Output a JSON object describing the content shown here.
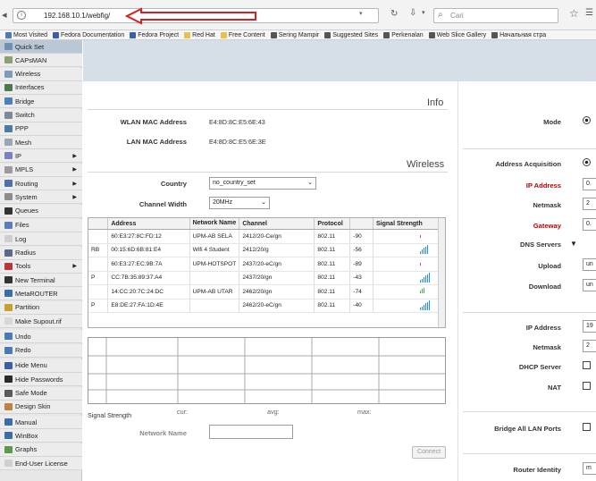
{
  "browser": {
    "url": "192.168.10.1/webfig/",
    "search_placeholder": "Cari"
  },
  "bookmarks": [
    "Most Visited",
    "Fedora Documentation",
    "Fedora Project",
    "Red Hat",
    "Free Content",
    "Sering Mampir",
    "Suggested Sites",
    "Perkenalan",
    "Web Slice Gallery",
    "Начальная стра"
  ],
  "sidebar": {
    "items": [
      {
        "label": "Quick Set",
        "color": "#6e8fb0",
        "arrow": ""
      },
      {
        "label": "CAPsMAN",
        "color": "#8aa070",
        "arrow": ""
      },
      {
        "label": "Wireless",
        "color": "#7d9cb8",
        "arrow": ""
      },
      {
        "label": "Interfaces",
        "color": "#4a7a4a",
        "arrow": ""
      },
      {
        "label": "Bridge",
        "color": "#4b7fc0",
        "arrow": ""
      },
      {
        "label": "Switch",
        "color": "#7f8a99",
        "arrow": ""
      },
      {
        "label": "PPP",
        "color": "#4a7aa8",
        "arrow": ""
      },
      {
        "label": "Mesh",
        "color": "#9aa6b3",
        "arrow": ""
      },
      {
        "label": "IP",
        "color": "#7b7fc6",
        "arrow": "▶"
      },
      {
        "label": "MPLS",
        "color": "#9b9b9b",
        "arrow": "▶"
      },
      {
        "label": "Routing",
        "color": "#4c6fb0",
        "arrow": "▶"
      },
      {
        "label": "System",
        "color": "#8c8c8c",
        "arrow": "▶"
      },
      {
        "label": "Queues",
        "color": "#333333",
        "arrow": ""
      },
      {
        "label": "Files",
        "color": "#5b7fb5",
        "arrow": ""
      },
      {
        "label": "Log",
        "color": "#cfcfcf",
        "arrow": ""
      },
      {
        "label": "Radius",
        "color": "#5a6a8a",
        "arrow": ""
      },
      {
        "label": "Tools",
        "color": "#b83838",
        "arrow": "▶"
      },
      {
        "label": "New Terminal",
        "color": "#333333",
        "arrow": ""
      },
      {
        "label": "MetaROUTER",
        "color": "#3b6ea8",
        "arrow": ""
      },
      {
        "label": "Partition",
        "color": "#c8a030",
        "arrow": ""
      },
      {
        "label": "Make Supout.rif",
        "color": "#d7d7d7",
        "arrow": ""
      },
      {
        "label": "Undo",
        "color": "#4a7ab8",
        "arrow": ""
      },
      {
        "label": "Redo",
        "color": "#4a7ab8",
        "arrow": ""
      },
      {
        "label": "Hide Menu",
        "color": "#3b5ea8",
        "arrow": ""
      },
      {
        "label": "Hide Passwords",
        "color": "#2a2a2a",
        "arrow": ""
      },
      {
        "label": "Safe Mode",
        "color": "#5a5a5a",
        "arrow": ""
      },
      {
        "label": "Design Skin",
        "color": "#c08040",
        "arrow": ""
      },
      {
        "label": "Manual",
        "color": "#3b6ea8",
        "arrow": ""
      },
      {
        "label": "WinBox",
        "color": "#3b6ea8",
        "arrow": ""
      },
      {
        "label": "Graphs",
        "color": "#5a9a4a",
        "arrow": ""
      },
      {
        "label": "End-User License",
        "color": "#cfcfcf",
        "arrow": ""
      }
    ]
  },
  "info": {
    "title": "Info",
    "wlan_mac_label": "WLAN MAC Address",
    "wlan_mac": "E4:8D:8C:E5:6E:43",
    "lan_mac_label": "LAN MAC Address",
    "lan_mac": "E4:8D:8C:E5:6E:3E"
  },
  "wireless": {
    "title": "Wireless",
    "country_label": "Country",
    "country": "no_country_set",
    "channel_width_label": "Channel Width",
    "channel_width": "20MHz",
    "columns": [
      "Address",
      "Network Name",
      "Channel",
      "Protocol",
      "",
      "Signal Strength"
    ],
    "rows": [
      {
        "flag": "",
        "address": "60:E3:27:8C:FD:12",
        "name": "UPM-AB SELA",
        "channel": "2412/20-Ce/gn",
        "protocol": "802.11",
        "signal": "-90",
        "color": "#e05030"
      },
      {
        "flag": "RB",
        "address": "00:15:6D:6B:81:E4",
        "name": "Wifi 4 Student",
        "channel": "2412/20/g",
        "protocol": "802.11",
        "signal": "-56",
        "color": "#2f8fd8"
      },
      {
        "flag": "",
        "address": "60:E3:27:EC:9B:7A",
        "name": "UPM-HOTSPOT",
        "channel": "2437/20-eC/gn",
        "protocol": "802.11",
        "signal": "-89",
        "color": "#e05030"
      },
      {
        "flag": "P",
        "address": "CC:7B:35:89:37:A4",
        "name": "",
        "channel": "2437/20/gn",
        "protocol": "802.11",
        "signal": "-43",
        "color": "#2f8fd8"
      },
      {
        "flag": "",
        "address": "14:CC:20:7C:24:DC",
        "name": "UPM-AB UTAR",
        "channel": "2462/20/gn",
        "protocol": "802.11",
        "signal": "-74",
        "color": "#4caa50"
      },
      {
        "flag": "P",
        "address": "E8:DE:27:FA:1D:4E",
        "name": "",
        "channel": "2462/20-eC/gn",
        "protocol": "802.11",
        "signal": "-40",
        "color": "#2f8fd8"
      }
    ],
    "signal_label": "Signal Strength",
    "cur_label": "cur:",
    "avg_label": "avg:",
    "max_label": "max:",
    "network_name_label": "Network Name",
    "connect_label": "Connect"
  },
  "right": {
    "mode_label": "Mode",
    "address_acq_label": "Address Acquisition",
    "ip_label": "IP Address",
    "ip_value": "0.",
    "netmask_label": "Netmask",
    "netmask_value": "2",
    "gateway_label": "Gateway",
    "gateway_value": "0.",
    "dns_label": "DNS Servers",
    "upload_label": "Upload",
    "upload_value": "un",
    "download_label": "Download",
    "download_value": "un",
    "ip2_label": "IP Address",
    "ip2_value": "19",
    "netmask2_label": "Netmask",
    "netmask2_value": "2",
    "dhcp_label": "DHCP Server",
    "nat_label": "NAT",
    "bridge_lan_label": "Bridge All LAN Ports",
    "router_identity_label": "Router Identity",
    "router_identity_value": "m"
  },
  "colors": {
    "annotation_arrow": "#d42020",
    "header_bg": "#d6dfe7"
  }
}
